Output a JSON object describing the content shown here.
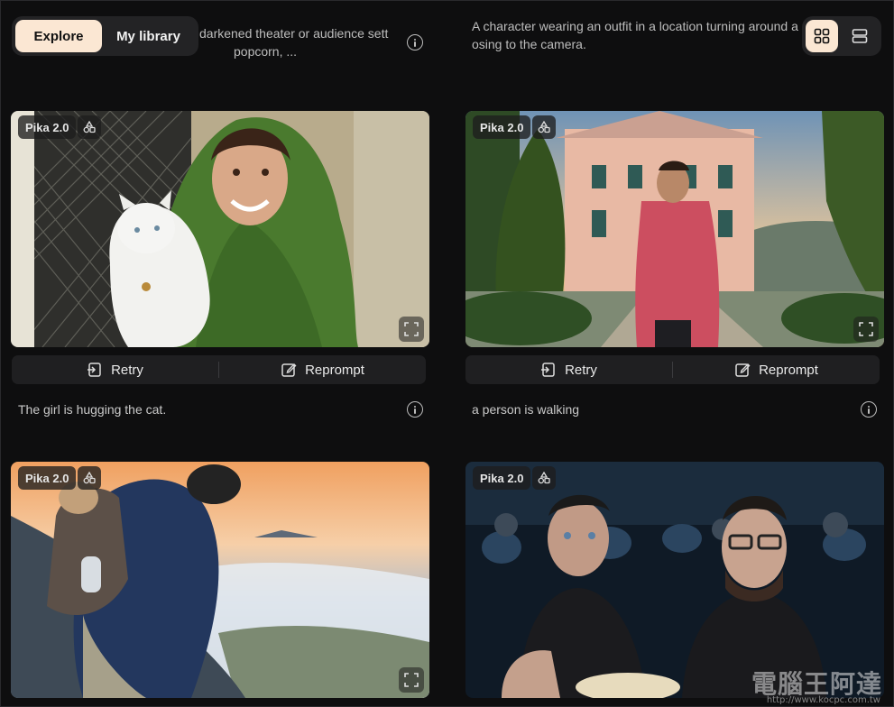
{
  "top": {
    "left_prompt_line1": "darkened theater or audience sett",
    "left_prompt_line2": "popcorn, ...",
    "right_prompt_line1": "A character wearing an outfit in a location turning around a",
    "right_prompt_line2": "osing to the camera."
  },
  "tabs": [
    {
      "label": "Explore",
      "active": true
    },
    {
      "label": "My library",
      "active": false
    }
  ],
  "view_toggle": {
    "grid_icon": "grid-icon",
    "list_icon": "list-icon",
    "active": "grid"
  },
  "cards": [
    {
      "badge": "Pika 2.0",
      "retry_label": "Retry",
      "reprompt_label": "Reprompt",
      "caption": "The girl is hugging the cat."
    },
    {
      "badge": "Pika 2.0",
      "retry_label": "Retry",
      "reprompt_label": "Reprompt",
      "caption": "a person is walking"
    },
    {
      "badge": "Pika 2.0"
    },
    {
      "badge": "Pika 2.0"
    }
  ],
  "watermark": {
    "text": "電腦王阿達",
    "sub": "http://www.kocpc.com.tw"
  },
  "colors": {
    "accent": "#fbe7d3",
    "background": "#0e0e0f",
    "panel": "#232325"
  }
}
